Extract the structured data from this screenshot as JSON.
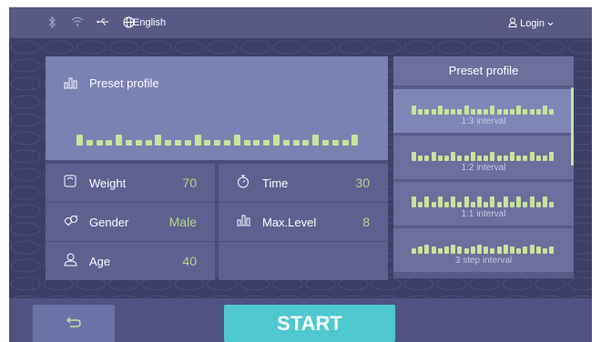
{
  "topbar": {
    "language": "English",
    "login": "Login",
    "icons": [
      "bluetooth-icon",
      "wifi-icon",
      "usb-icon",
      "globe-icon",
      "user-icon",
      "chevron-down-icon"
    ]
  },
  "left_panel": {
    "preset_title": "Preset profile",
    "info": [
      {
        "label": "Weight",
        "value": "70"
      },
      {
        "label": "Time",
        "value": "30"
      },
      {
        "label": "Gender",
        "value": "Male"
      },
      {
        "label": "Max.Level",
        "value": "8"
      },
      {
        "label": "Age",
        "value": "40"
      }
    ]
  },
  "right_panel": {
    "title": "Preset profile",
    "items": [
      {
        "caption": "1:3 interval"
      },
      {
        "caption": "1:2 interval"
      },
      {
        "caption": "1:1 interval"
      },
      {
        "caption": "3 step interval"
      }
    ]
  },
  "footer": {
    "start_label": "START"
  },
  "colors": {
    "accent_green": "#c9e39a",
    "start_button": "#4fc8cf",
    "panel_dark": "#3c3f65"
  }
}
